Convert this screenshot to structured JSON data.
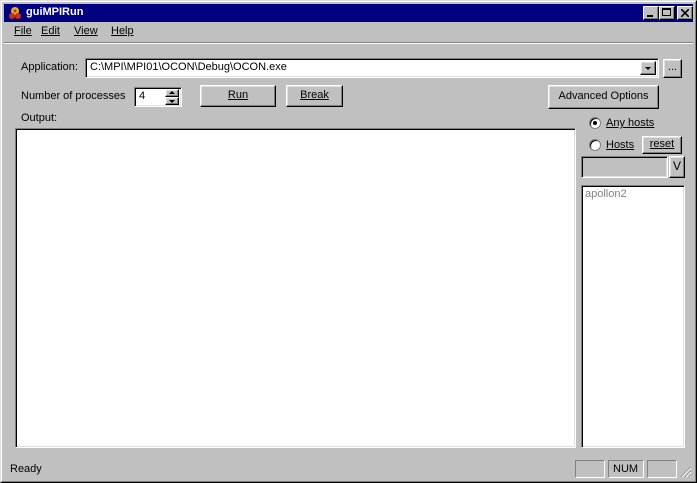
{
  "window": {
    "title": "guiMPIRun"
  },
  "menu": [
    {
      "label": "File",
      "hotkey_index": 0
    },
    {
      "label": "Edit",
      "hotkey_index": 0
    },
    {
      "label": "View",
      "hotkey_index": 0
    },
    {
      "label": "Help",
      "hotkey_index": 0
    }
  ],
  "app": {
    "application_label": "Application:",
    "application_value": "C:\\MPI\\MPI01\\OCON\\Debug\\OCON.exe",
    "browse_label": "...",
    "processes_label": "Number of processes",
    "processes_value": "4",
    "run_label": "Run",
    "break_label": "Break",
    "advanced_label": "Advanced Options",
    "output_label": "Output:"
  },
  "hosts": {
    "any_hosts_label": "Any hosts",
    "hosts_label": "Hosts",
    "reset_label": "reset",
    "v_label": "V",
    "selected": "any",
    "list": [
      "apollon2"
    ]
  },
  "status": {
    "text": "Ready",
    "num": "NUM"
  }
}
